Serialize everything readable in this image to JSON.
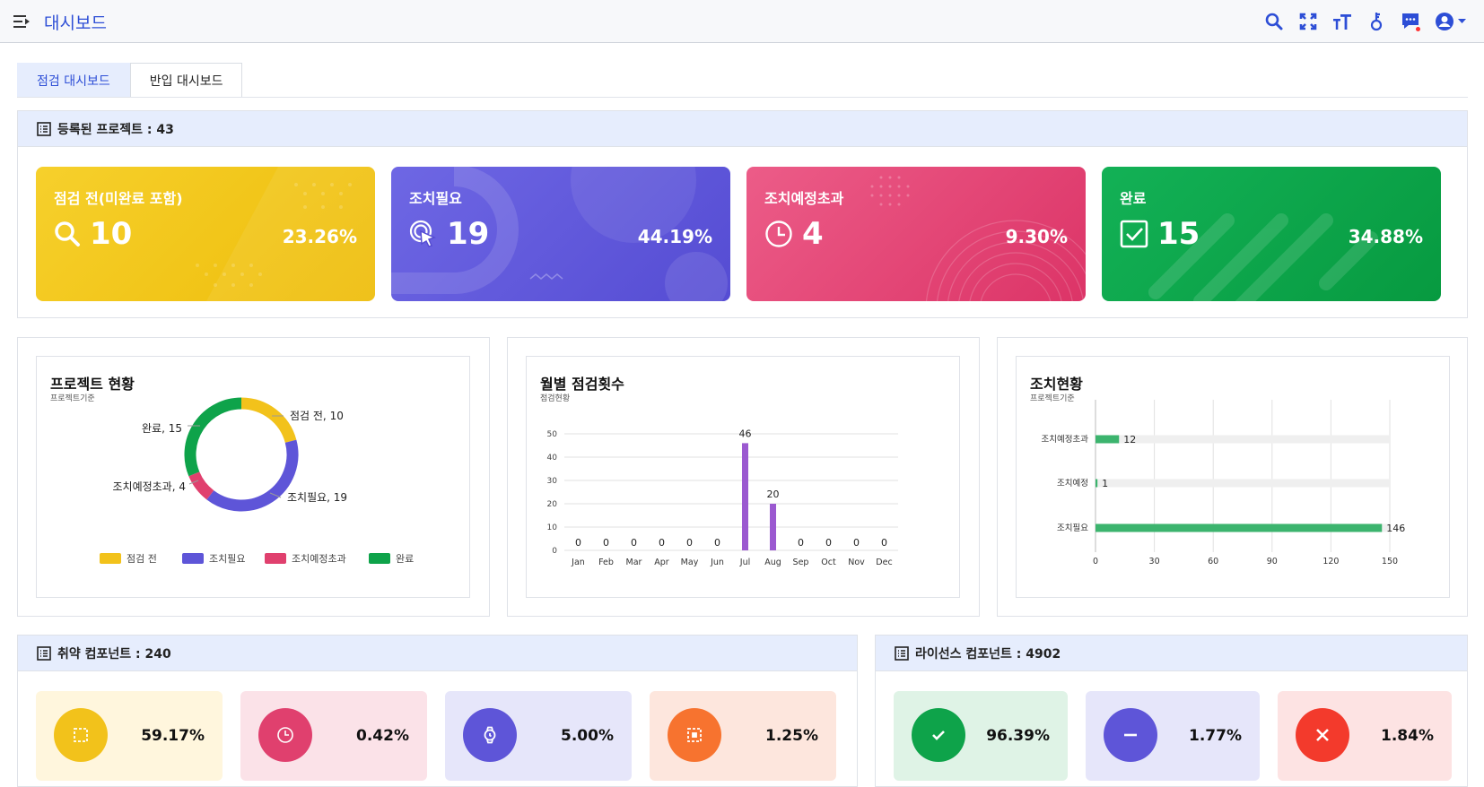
{
  "header": {
    "title": "대시보드",
    "icons": [
      "menu-icon",
      "search-icon",
      "fullscreen-icon",
      "font-size-icon",
      "key-icon",
      "chat-icon",
      "user-icon",
      "caret-down-icon"
    ]
  },
  "tabs": [
    {
      "label": "점검 대시보드",
      "active": true
    },
    {
      "label": "반입 대시보드",
      "active": false
    }
  ],
  "projects": {
    "heading": "등록된 프로젝트 : 43",
    "cards": [
      {
        "title": "점검 전(미완료 포함)",
        "count": "10",
        "percent": "23.26%",
        "icon": "search-icon",
        "color": "#f2c21b"
      },
      {
        "title": "조치필요",
        "count": "19",
        "percent": "44.19%",
        "icon": "touch-icon",
        "color": "#5e55d8"
      },
      {
        "title": "조치예정초과",
        "count": "4",
        "percent": "9.30%",
        "icon": "clock-icon",
        "color": "#e0406e"
      },
      {
        "title": "완료",
        "count": "15",
        "percent": "34.88%",
        "icon": "check-square-icon",
        "color": "#0ea34a"
      }
    ]
  },
  "charts": {
    "project_status": {
      "title": "프로젝트 현황",
      "subtitle": "프로젝트기준"
    },
    "monthly": {
      "title": "월별 점검횟수",
      "subtitle": "점검현황"
    },
    "action": {
      "title": "조치현황",
      "subtitle": "프로젝트기준"
    }
  },
  "chart_data": [
    {
      "type": "pie",
      "title": "프로젝트 현황",
      "subtitle": "프로젝트기준",
      "categories": [
        "점검 전",
        "조치필요",
        "조치예정초과",
        "완료"
      ],
      "values": [
        10,
        19,
        4,
        15
      ],
      "data_labels": [
        "점검 전, 10",
        "조치필요, 19",
        "조치예정초과, 4",
        "완료, 15"
      ],
      "colors": [
        "#f2c21b",
        "#5e55d8",
        "#e0406e",
        "#0ea34a"
      ],
      "donut": true,
      "legend": "bottom"
    },
    {
      "type": "bar",
      "title": "월별 점검횟수",
      "subtitle": "점검현황",
      "categories": [
        "Jan",
        "Feb",
        "Mar",
        "Apr",
        "May",
        "Jun",
        "Jul",
        "Aug",
        "Sep",
        "Oct",
        "Nov",
        "Dec"
      ],
      "values": [
        0,
        0,
        0,
        0,
        0,
        0,
        46,
        20,
        0,
        0,
        0,
        0
      ],
      "yticks": [
        0,
        10,
        20,
        30,
        40,
        50
      ],
      "ylim": [
        0,
        50
      ],
      "color": "#9b59d0",
      "grid": true
    },
    {
      "type": "bar",
      "orientation": "horizontal",
      "title": "조치현황",
      "subtitle": "프로젝트기준",
      "categories": [
        "조치예정초과",
        "조치예정",
        "조치필요"
      ],
      "values": [
        12,
        1,
        146
      ],
      "xticks": [
        0,
        30,
        60,
        90,
        120,
        150
      ],
      "xlim": [
        0,
        150
      ],
      "color": "#3cb46e",
      "track_color": "#efefef",
      "grid": true
    }
  ],
  "vulnerable": {
    "heading": "취약 컴포넌트 : 240",
    "cards": [
      {
        "value": "59.17%",
        "icon": "dashed-square-icon",
        "bg": "#fff6dd",
        "circle": "#f2c21b"
      },
      {
        "value": "0.42%",
        "icon": "clock-icon",
        "bg": "#fbe2e8",
        "circle": "#e0406e"
      },
      {
        "value": "5.00%",
        "icon": "watch-icon",
        "bg": "#e6e6fa",
        "circle": "#5e55d8"
      },
      {
        "value": "1.25%",
        "icon": "dashed-box-icon",
        "bg": "#fde6dd",
        "circle": "#f7732f"
      }
    ]
  },
  "license": {
    "heading": "라이선스 컴포넌트 : 4902",
    "cards": [
      {
        "value": "96.39%",
        "icon": "check-icon",
        "bg": "#dff3e6",
        "circle": "#0ea34a"
      },
      {
        "value": "1.77%",
        "icon": "minus-icon",
        "bg": "#e6e6fa",
        "circle": "#5e55d8"
      },
      {
        "value": "1.84%",
        "icon": "close-icon",
        "bg": "#fde3e3",
        "circle": "#f33a2c"
      }
    ]
  }
}
